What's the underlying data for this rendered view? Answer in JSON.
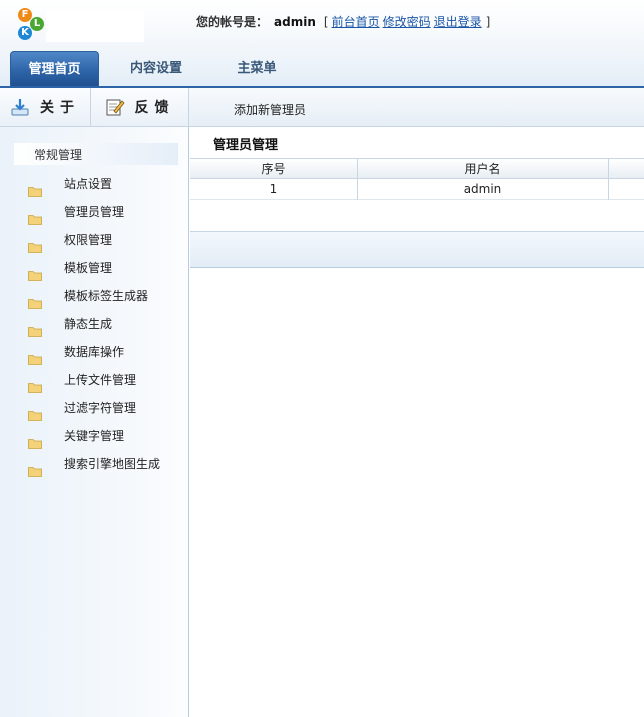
{
  "header": {
    "logo_letters": [
      "F",
      "L",
      "K"
    ],
    "account_label": "您的帐号是：",
    "username": "admin",
    "bracket_open": "[",
    "links": [
      "前台首页",
      "修改密码",
      "退出登录"
    ],
    "bracket_close": "]"
  },
  "tabs": [
    {
      "label": "管理首页",
      "active": true
    },
    {
      "label": "内容设置",
      "active": false
    },
    {
      "label": "主菜单",
      "active": false
    }
  ],
  "toolbar": {
    "about_label": "关于",
    "feedback_label": "反馈",
    "add_admin_label": "添加新管理员"
  },
  "sidebar": {
    "heading": "常规管理",
    "items": [
      {
        "label": "站点设置"
      },
      {
        "label": "管理员管理"
      },
      {
        "label": "权限管理"
      },
      {
        "label": "模板管理"
      },
      {
        "label": "模板标签生成器"
      },
      {
        "label": "静态生成"
      },
      {
        "label": "数据库操作"
      },
      {
        "label": "上传文件管理"
      },
      {
        "label": "过滤字符管理"
      },
      {
        "label": "关键字管理"
      },
      {
        "label": "搜索引擎地图生成"
      }
    ]
  },
  "main": {
    "title": "管理员管理",
    "columns": [
      "序号",
      "用户名",
      ""
    ],
    "rows": [
      {
        "index": "1",
        "username": "admin"
      }
    ]
  },
  "colors": {
    "accent": "#2d64a8",
    "link": "#1a55a8",
    "folder": "#f4d27a"
  },
  "icons": {
    "about": "download-arrow-icon",
    "feedback": "edit-note-icon",
    "sidebar_item": "folder-icon"
  }
}
